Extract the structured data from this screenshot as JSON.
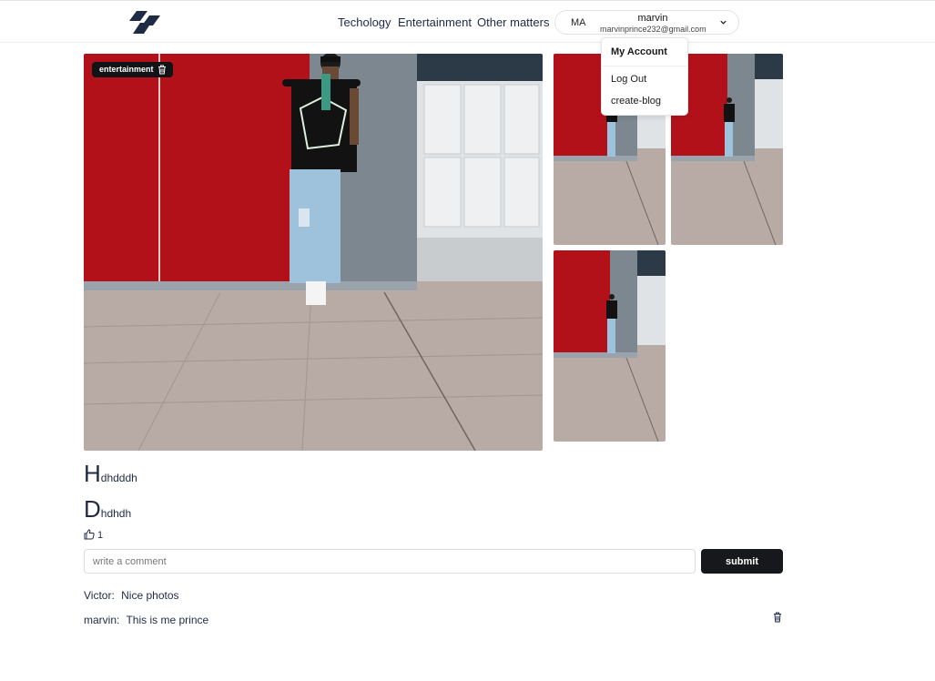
{
  "header": {
    "nav": [
      "Techology",
      "Entertainment",
      "Other matters"
    ],
    "user": {
      "initials": "MA",
      "name": "marvin",
      "email": "marvinprince232@gmail.com"
    }
  },
  "dropdown": {
    "title": "My Account",
    "items": [
      "Log Out",
      "create-blog"
    ]
  },
  "post": {
    "category": "entertainment",
    "title": {
      "initial": "H",
      "rest": "dhdddh"
    },
    "description": {
      "initial": "D",
      "rest": "hdhdh"
    },
    "likes": "1"
  },
  "comment_form": {
    "placeholder": "write a comment",
    "submit_label": "submit"
  },
  "comments": [
    {
      "author": "Victor:",
      "text": "Nice photos"
    },
    {
      "author": "marvin:",
      "text": "This is me prince"
    }
  ],
  "colors": {
    "brand": "#1f2a44",
    "dark_button": "#17181b",
    "wall_red": "#b5121b",
    "floor": "#b7a9a3"
  },
  "icons": [
    "logo-icon",
    "chevron-down-icon",
    "trash-icon",
    "thumbs-up-icon"
  ]
}
